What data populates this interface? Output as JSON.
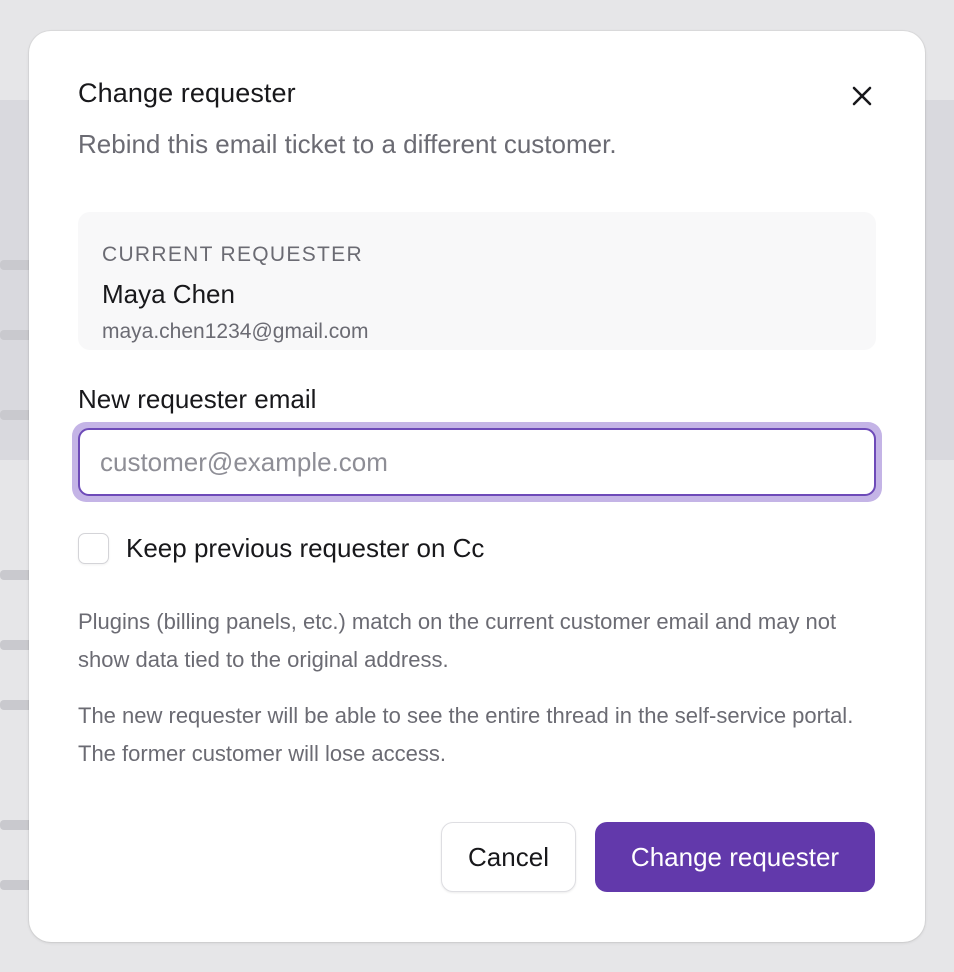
{
  "dialog": {
    "title": "Change requester",
    "subtitle": "Rebind this email ticket to a different customer.",
    "close_icon": "close-icon"
  },
  "current_requester": {
    "label": "CURRENT REQUESTER",
    "name": "Maya Chen",
    "email": "maya.chen1234@gmail.com"
  },
  "new_requester": {
    "label": "New requester email",
    "value": "",
    "placeholder": "customer@example.com"
  },
  "keep_cc": {
    "label": "Keep previous requester on Cc",
    "checked": false
  },
  "notes": [
    "Plugins (billing panels, etc.) match on the current customer email and may not show data tied to the original address.",
    "The new requester will be able to see the entire thread in the self-service portal. The former customer will lose access."
  ],
  "actions": {
    "cancel_label": "Cancel",
    "confirm_label": "Change requester"
  },
  "colors": {
    "primary": "#6239ab",
    "focus_ring": "#c4b4e6",
    "muted_text": "#6b6b73"
  }
}
